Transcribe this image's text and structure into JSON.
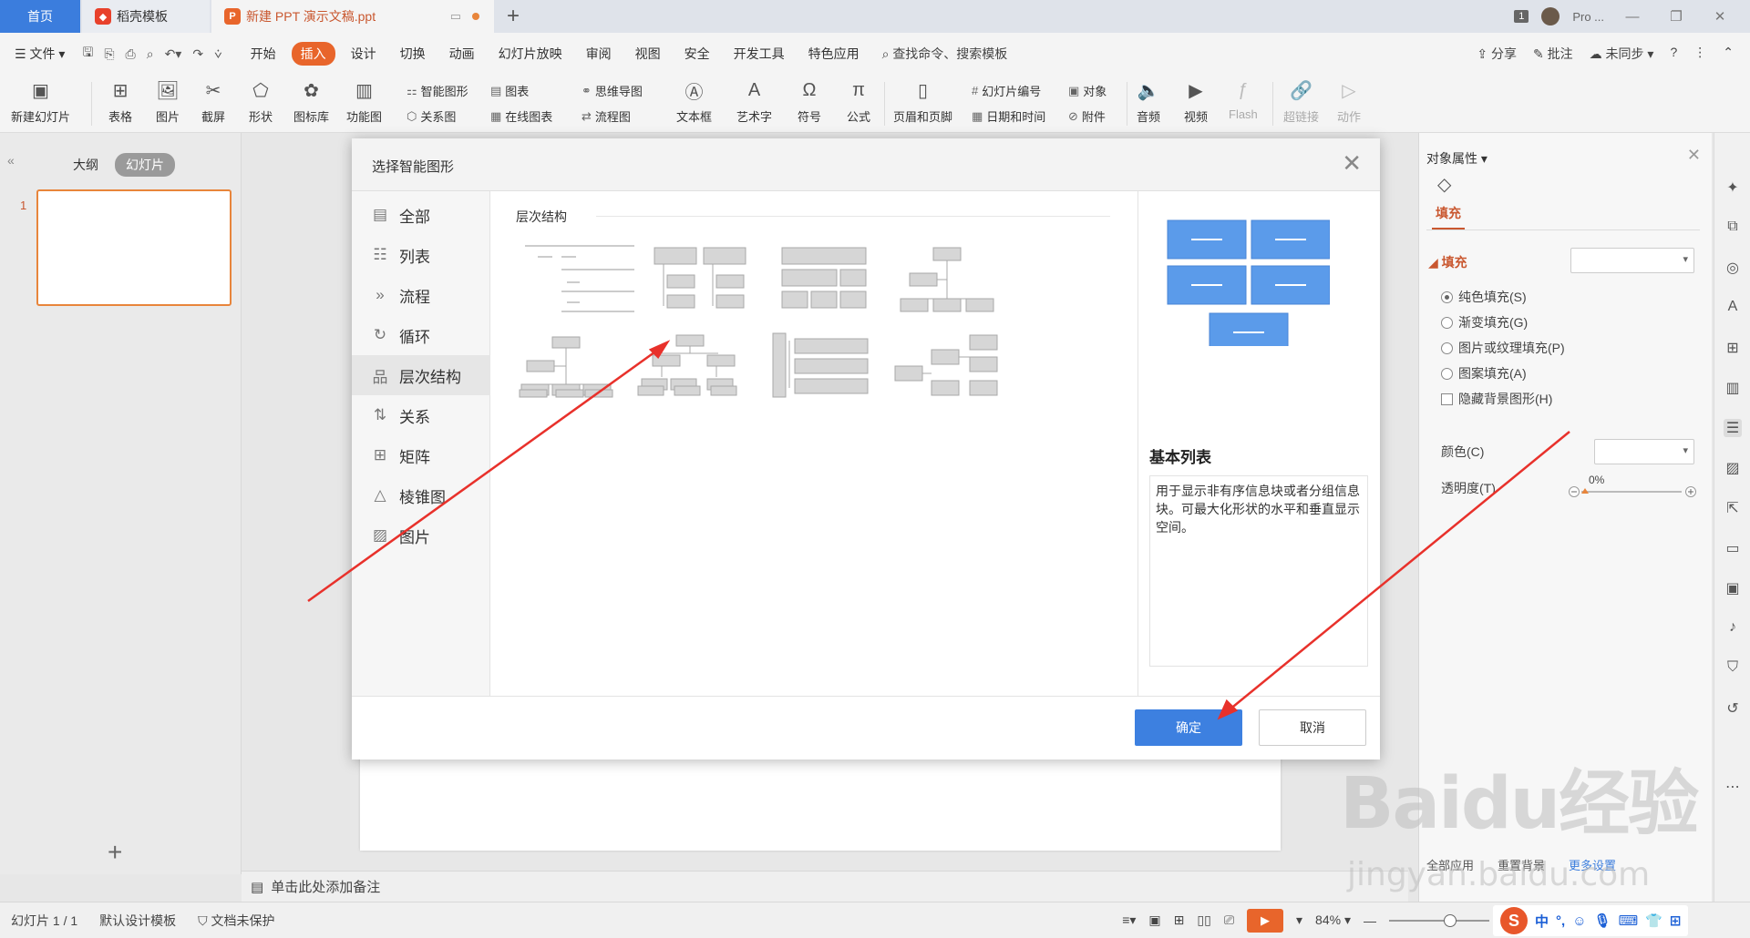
{
  "tabs": {
    "home": "首页",
    "templates": "稻壳模板",
    "document": "新建 PPT 演示文稿.ppt",
    "new_tab": "+"
  },
  "titlebar": {
    "count_badge": "1",
    "user": "Pro ..."
  },
  "menu": {
    "file": "文件",
    "items": [
      "开始",
      "插入",
      "设计",
      "切换",
      "动画",
      "幻灯片放映",
      "审阅",
      "视图",
      "安全",
      "开发工具",
      "特色应用"
    ],
    "active": "插入",
    "search": "查找命令、搜索模板",
    "share": "分享",
    "comment": "批注",
    "sync": "未同步"
  },
  "ribbon": {
    "new_slide": "新建幻灯片",
    "table": "表格",
    "picture": "图片",
    "screenshot": "截屏",
    "shape": "形状",
    "icon_lib": "图标库",
    "function_chart": "功能图",
    "smartart": "智能图形",
    "chart": "图表",
    "relation": "关系图",
    "online_chart": "在线图表",
    "mindmap": "思维导图",
    "flowchart": "流程图",
    "textbox": "文本框",
    "wordart": "艺术字",
    "symbol": "符号",
    "formula": "公式",
    "header_footer": "页眉和页脚",
    "slide_number": "幻灯片编号",
    "object": "对象",
    "datetime": "日期和时间",
    "attachment": "附件",
    "audio": "音频",
    "video": "视频",
    "flash": "Flash",
    "hyperlink": "超链接",
    "action": "动作"
  },
  "leftpane": {
    "outline": "大纲",
    "slides": "幻灯片",
    "slide_number": "1",
    "add": "+"
  },
  "notes": {
    "placeholder": "单击此处添加备注"
  },
  "dialog": {
    "title": "选择智能图形",
    "categories": [
      "全部",
      "列表",
      "流程",
      "循环",
      "层次结构",
      "关系",
      "矩阵",
      "棱锥图",
      "图片"
    ],
    "active_category": "层次结构",
    "section_title": "层次结构",
    "preview_name": "基本列表",
    "preview_desc": "用于显示非有序信息块或者分组信息块。可最大化形状的水平和垂直显示空间。",
    "ok": "确定",
    "cancel": "取消"
  },
  "properties": {
    "title": "对象属性",
    "fill_tab": "填充",
    "fill_section": "填充",
    "options": [
      "纯色填充(S)",
      "渐变填充(G)",
      "图片或纹理填充(P)",
      "图案填充(A)"
    ],
    "selected_option": "纯色填充(S)",
    "hide_bg": "隐藏背景图形(H)",
    "color_label": "颜色(C)",
    "transparency_label": "透明度(T)",
    "transparency_value": "0%",
    "apply_all": "全部应用",
    "reset": "重置背景",
    "more": "更多设置"
  },
  "status": {
    "slide": "幻灯片 1 / 1",
    "theme": "默认设计模板",
    "protect": "文档未保护",
    "zoom": "84%"
  },
  "ime": {
    "mode": "中"
  },
  "watermark": {
    "brand": "Baidu经验",
    "url": "jingyan.baidu.com"
  },
  "colors": {
    "accent": "#e8652b",
    "primary": "#3d80e0",
    "preview_shape": "#5b9bea",
    "arrow": "#e8312b"
  }
}
